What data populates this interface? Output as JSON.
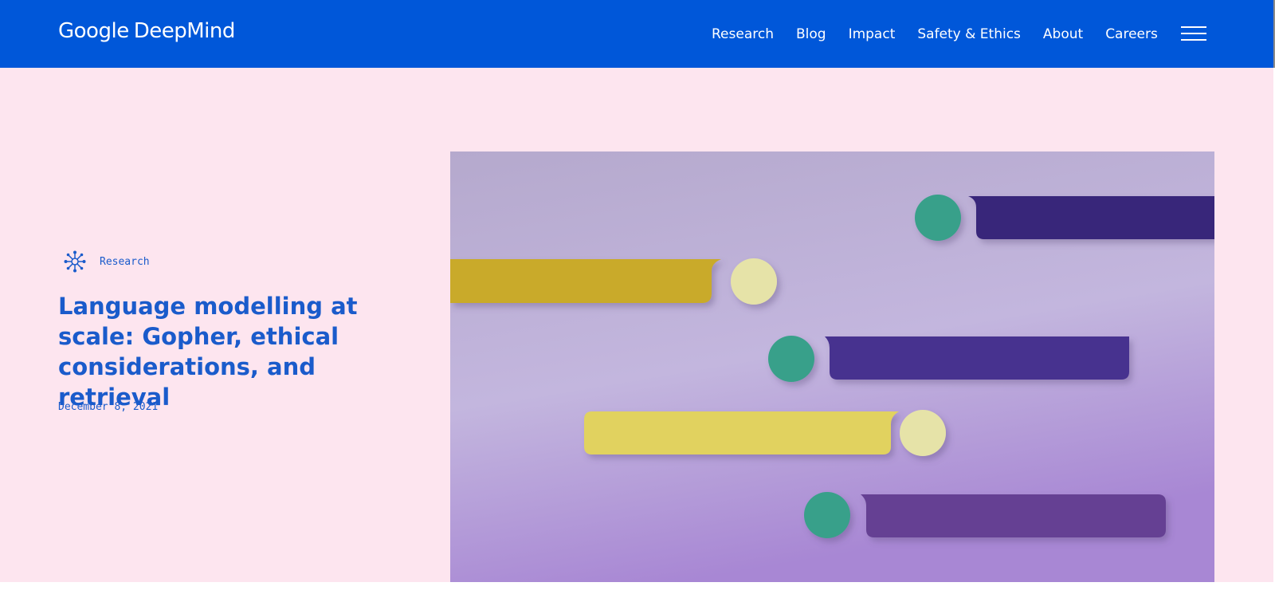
{
  "brand": {
    "google": "Google",
    "deepmind": "DeepMind"
  },
  "nav": {
    "items": [
      {
        "label": "Research"
      },
      {
        "label": "Blog"
      },
      {
        "label": "Impact"
      },
      {
        "label": "Safety & Ethics"
      },
      {
        "label": "About"
      },
      {
        "label": "Careers"
      }
    ]
  },
  "article": {
    "category": "Research",
    "category_icon": "network-nodes-icon",
    "title": "Language modelling at scale: Gopher, ethical considerations, and retrieval",
    "date": "December 8, 2021"
  },
  "colors": {
    "header_bg": "#0057d9",
    "hero_bg": "#fde5ef",
    "accent_text": "#1a5bcb"
  }
}
